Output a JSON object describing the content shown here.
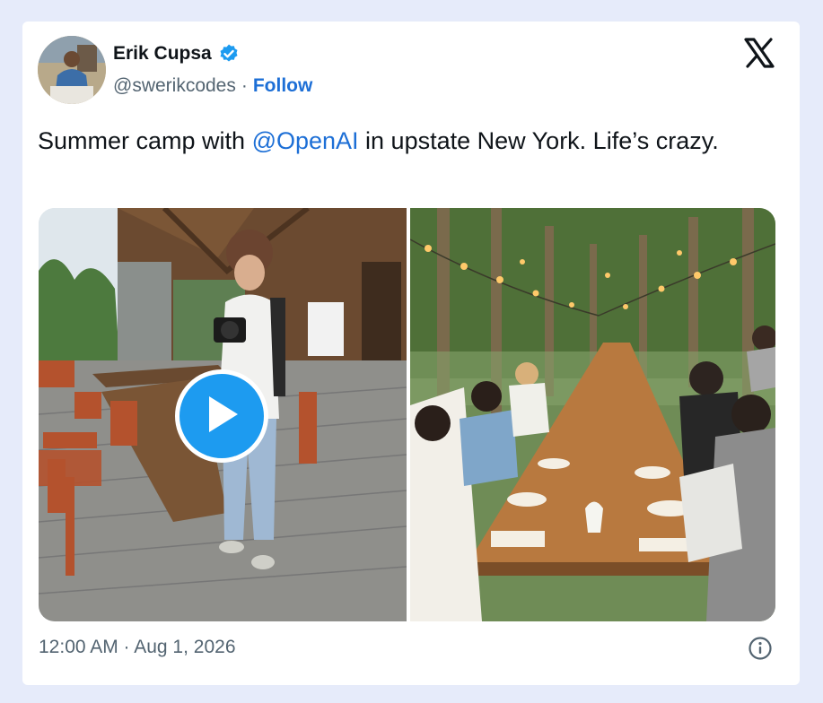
{
  "author": {
    "name": "Erik Cupsa",
    "handle": "@swerikcodes",
    "separator": "·",
    "follow_label": "Follow",
    "verified_icon": "verified-badge-icon"
  },
  "tweet": {
    "text_before": "Summer camp with ",
    "mention": "@OpenAI",
    "text_after": " in upstate New York. Life’s crazy."
  },
  "media": {
    "left": {
      "type": "video",
      "play_icon": "play-icon"
    },
    "right": {
      "type": "photo"
    }
  },
  "footer": {
    "timestamp": "12:00 AM · Aug 1, 2026",
    "info_icon": "info-icon"
  },
  "brand": {
    "logo": "x-logo-icon",
    "accent": "#1d9bf0",
    "link": "#1d6fd6",
    "background": "#e6ebfa"
  }
}
